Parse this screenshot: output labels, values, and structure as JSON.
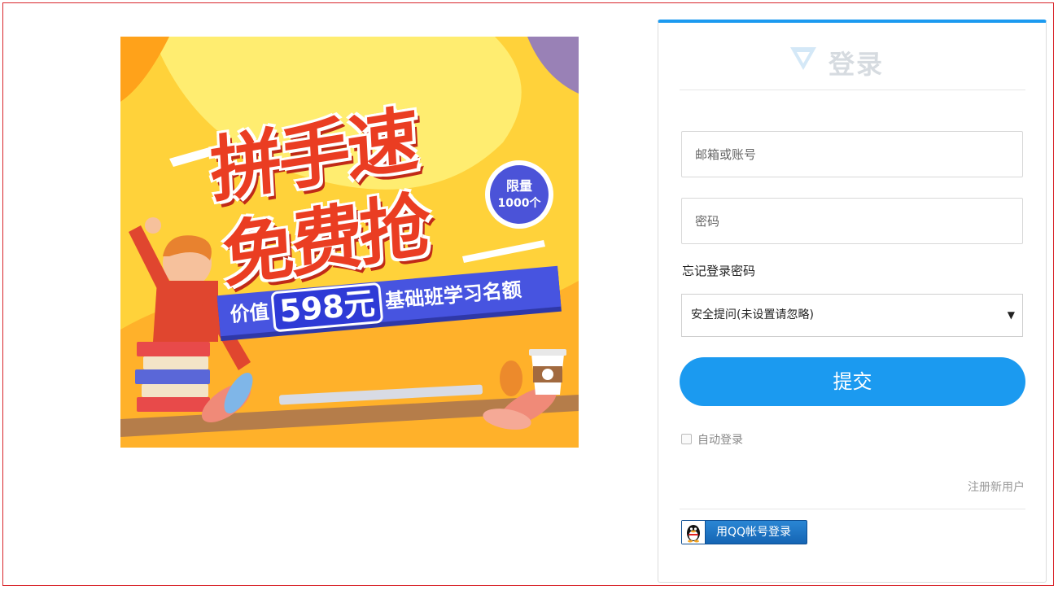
{
  "banner": {
    "headline_line1": "拼手速",
    "headline_line2": "免费抢",
    "limit_line1": "限量",
    "limit_line2": "1000个",
    "value_prefix": "价值",
    "value_price": "598元",
    "value_suffix": "基础班学习名额"
  },
  "login": {
    "title": "登录",
    "username_placeholder": "邮箱或账号",
    "password_placeholder": "密码",
    "forgot_label": "忘记登录密码",
    "security_question_selected": "安全提问(未设置请忽略)",
    "submit_label": "提交",
    "remember_label": "自动登录",
    "register_link": "注册新用户",
    "qq_login_label": "用QQ帐号登录"
  },
  "colors": {
    "accent": "#1b9af0",
    "frame_border": "#d9262c",
    "banner_yellow": "#ffd23a",
    "headline_red": "#ea3d22",
    "ribbon_blue": "#4754e0"
  }
}
